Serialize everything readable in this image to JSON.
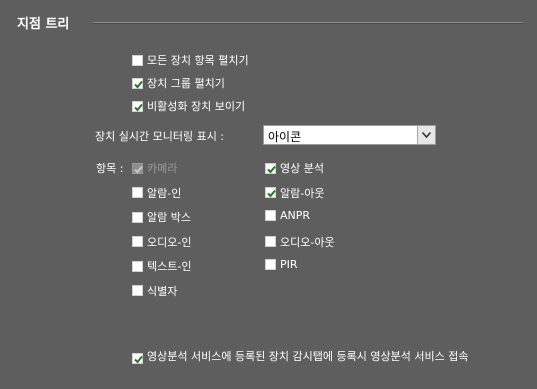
{
  "section": {
    "title": "지점 트리"
  },
  "options": [
    {
      "label": "모든 장치 항목 펼치기",
      "checked": false
    },
    {
      "label": "장치 그룹 펼치기",
      "checked": true
    },
    {
      "label": "비활성화 장치 보이기",
      "checked": true
    }
  ],
  "monitor": {
    "label": "장치 실시간 모니터링 표시 :",
    "value": "아이콘"
  },
  "items": {
    "label": "항목 :",
    "left": [
      {
        "label": "카메라",
        "checked": true,
        "disabled": true
      },
      {
        "label": "알람-인",
        "checked": false,
        "disabled": false
      },
      {
        "label": "알람 박스",
        "checked": false,
        "disabled": false
      },
      {
        "label": "오디오-인",
        "checked": false,
        "disabled": false
      },
      {
        "label": "텍스트-인",
        "checked": false,
        "disabled": false
      },
      {
        "label": "식별자",
        "checked": false,
        "disabled": false
      }
    ],
    "right": [
      {
        "label": "영상 분석",
        "checked": true,
        "disabled": false
      },
      {
        "label": "알람-아웃",
        "checked": true,
        "disabled": false
      },
      {
        "label": "ANPR",
        "checked": false,
        "disabled": false
      },
      {
        "label": "오디오-아웃",
        "checked": false,
        "disabled": false
      },
      {
        "label": "PIR",
        "checked": false,
        "disabled": false
      }
    ]
  },
  "footer": {
    "label": "영상분석 서비스에 등록된 장치 감시탭에 등록시 영상분석 서비스 접속",
    "checked": true
  }
}
